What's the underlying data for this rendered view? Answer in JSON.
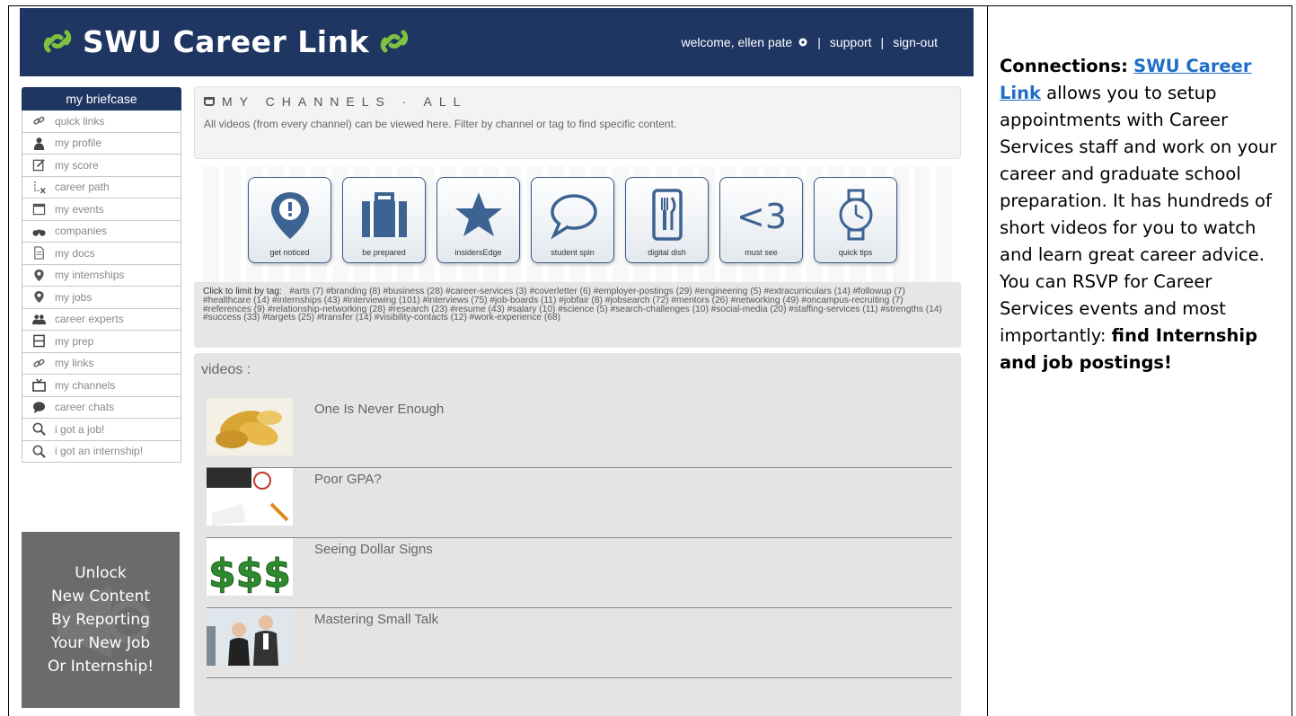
{
  "header": {
    "brand": "SWU Career Link",
    "welcome": "welcome, ellen pate",
    "support": "support",
    "sign_out": "sign-out",
    "sep": "|"
  },
  "sidebar": {
    "heading": "my briefcase",
    "items": [
      {
        "label": "quick links",
        "icon": "link-icon"
      },
      {
        "label": "my profile",
        "icon": "person-icon"
      },
      {
        "label": "my score",
        "icon": "edit-icon"
      },
      {
        "label": "career path",
        "icon": "path-icon"
      },
      {
        "label": "my events",
        "icon": "calendar-icon"
      },
      {
        "label": "companies",
        "icon": "binoculars-icon"
      },
      {
        "label": "my docs",
        "icon": "document-icon"
      },
      {
        "label": "my internships",
        "icon": "map-pin-icon"
      },
      {
        "label": "my jobs",
        "icon": "map-pin-icon"
      },
      {
        "label": "career experts",
        "icon": "group-icon"
      },
      {
        "label": "my prep",
        "icon": "film-icon"
      },
      {
        "label": "my links",
        "icon": "link-icon"
      },
      {
        "label": "my channels",
        "icon": "tv-icon"
      },
      {
        "label": "career chats",
        "icon": "chat-bubble-icon"
      },
      {
        "label": "i got a job!",
        "icon": "magnifier-icon"
      },
      {
        "label": "i got an internship!",
        "icon": "magnifier-icon"
      }
    ],
    "promo_lines": [
      "Unlock",
      "New Content",
      "By Reporting",
      "Your New Job",
      "Or Internship!"
    ]
  },
  "channels": {
    "title": "MY CHANNELS · ALL",
    "description": "All videos (from every channel) can be viewed here. Filter by channel or tag to find specific content.",
    "tiles": [
      {
        "label": "get noticed",
        "icon": "exclamation-pin-icon"
      },
      {
        "label": "be prepared",
        "icon": "briefcase-icon"
      },
      {
        "label": "insidersEdge",
        "icon": "star-icon"
      },
      {
        "label": "student spin",
        "icon": "speech-bubble-icon"
      },
      {
        "label": "digital dish",
        "icon": "phone-dish-icon"
      },
      {
        "label": "must see",
        "icon": "heart-text-icon"
      },
      {
        "label": "quick tips",
        "icon": "watch-icon"
      }
    ],
    "heart_text": "<3"
  },
  "tags": {
    "label": "Click to limit by tag:",
    "text": "#arts (7)   #branding (8)   #business (28)   #career-services (3)   #coverletter (6)   #employer-postings (29)   #engineering (5)   #extracurriculars (14)   #followup (7)   #healthcare (14)   #internships (43)   #interviewing (101)   #interviews (75)   #job-boards (11)   #jobfair (8)   #jobsearch (72)   #mentors (26)   #networking (49)   #oncampus-recruiting (7)   #references (9)   #relationship-networking (28)   #research (23)   #resume (43)   #salary (10)   #science (5)   #search-challenges (10)   #social-media (20)   #staffing-services (11)   #strengths (14)   #success (33)   #targets (25)   #transfer (14)   #visibility-contacts (12)   #work-experience (68)"
  },
  "videos": {
    "title": "videos :",
    "items": [
      {
        "title": "One Is Never Enough",
        "thumb": "chips-thumbnail"
      },
      {
        "title": "Poor GPA?",
        "thumb": "exam-thumbnail"
      },
      {
        "title": "Seeing Dollar Signs",
        "thumb": "dollar-thumbnail"
      },
      {
        "title": "Mastering Small Talk",
        "thumb": "people-thumbnail"
      }
    ],
    "dollar_text": "$$$"
  },
  "description": {
    "heading": "Connections",
    "colon": ":",
    "link": "SWU Career Link",
    "body": " allows you to setup appointments with Career Services staff and work on your career and graduate school preparation. It has hundreds of short videos for you to watch and learn great career advice. You can RSVP for Career Services events and most importantly: ",
    "emphasis": "find Internship and job postings!"
  },
  "colors": {
    "navy": "#1f3663",
    "link_blue": "#1e6ec8",
    "promo_gray": "#6b6b6b",
    "panel_gray": "#e4e4e4"
  }
}
